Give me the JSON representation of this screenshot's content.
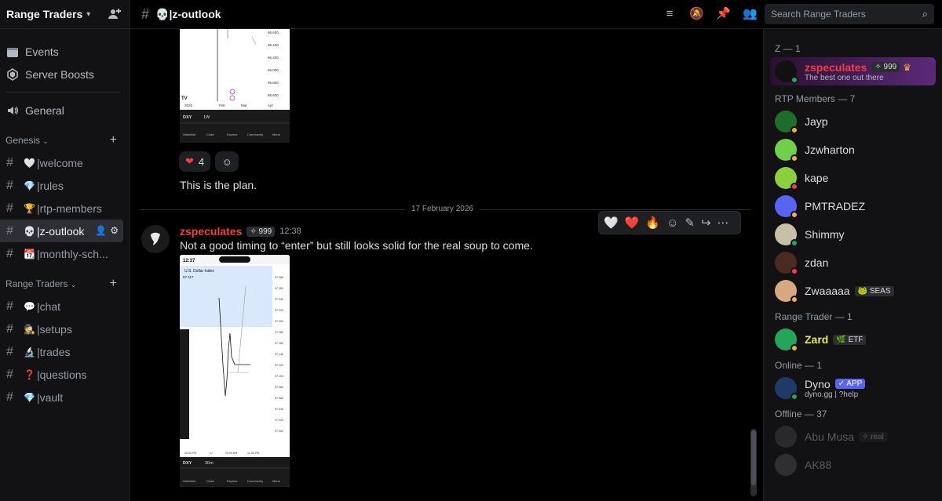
{
  "server": {
    "name": "Range Traders"
  },
  "nav": [
    {
      "label": "Events",
      "icon": "calendar-icon"
    },
    {
      "label": "Server Boosts",
      "icon": "boost-icon"
    },
    {
      "label": "General",
      "icon": "speaker-icon"
    }
  ],
  "categories": [
    {
      "label": "Genesis",
      "channels": [
        {
          "emoji": "🤍",
          "name": "|welcome"
        },
        {
          "emoji": "💎",
          "name": "|rules"
        },
        {
          "emoji": "🏆",
          "name": "|rtp-members"
        },
        {
          "emoji": "💀",
          "name": "|z-outlook",
          "active": true
        },
        {
          "emoji": "📆",
          "name": "|monthly-sch..."
        }
      ]
    },
    {
      "label": "Range Traders",
      "channels": [
        {
          "emoji": "💬",
          "name": "|chat"
        },
        {
          "emoji": "🕵",
          "name": "|setups"
        },
        {
          "emoji": "🔬",
          "name": "|trades"
        },
        {
          "emoji": "❓",
          "name": "|questions"
        },
        {
          "emoji": "💎",
          "name": "|vault"
        }
      ]
    }
  ],
  "topbar": {
    "title": "💀|z-outlook",
    "search_placeholder": "Search Range Traders"
  },
  "chat": {
    "prev": {
      "reaction_count": "4",
      "text": "This is the plan."
    },
    "divider": "17 February 2026",
    "msg": {
      "author": "zspeculates",
      "badge": "✧ 999",
      "time": "12:38",
      "text": "Not a good timing to “enter” but still looks solid for the real soup to come."
    },
    "hover_reactions": [
      "🤍",
      "❤️",
      "🔥"
    ]
  },
  "members": {
    "groups": [
      {
        "label": "Z — 1"
      },
      {
        "label": "RTP Members — 7"
      },
      {
        "label": "Range Trader — 1"
      },
      {
        "label": "Online — 1"
      },
      {
        "label": "Offline — 37"
      }
    ],
    "z": {
      "name": "zspeculates",
      "tag": "✧ 999",
      "status": "The best one out there"
    },
    "rtp": [
      "Jayp",
      "Jzwharton",
      "kape",
      "PMTRADEZ",
      "Shimmy",
      "zdan",
      "Zwaaaaa"
    ],
    "zwa_tag": "🐸 SEAS",
    "rt": {
      "name": "Zard",
      "tag": "🌿 ETF"
    },
    "online": {
      "name": "Dyno",
      "tag": "✓ APP",
      "status": "dyno.gg | ?help"
    },
    "offline": [
      "Abu Musa",
      "AK88"
    ],
    "offline_tag": "✧ real"
  },
  "chart1": {
    "ticks": [
      "96.600",
      "96.400",
      "96.200",
      "96.000",
      "95.800",
      "95.600"
    ],
    "toolbar": [
      "DXY",
      "1W"
    ],
    "bottom": [
      "Watchlist",
      "Chart",
      "Explore",
      "Community",
      "Menu"
    ],
    "x_labels": [
      "2026",
      "Feb",
      "Mar",
      "Apr"
    ]
  },
  "chart2": {
    "time": "12:37",
    "title": "U.S. Dollar Index",
    "value": "97.117",
    "ticks": [
      "97.280",
      "97.260",
      "97.240",
      "97.220",
      "97.200",
      "97.180",
      "97.160",
      "97.140",
      "97.120",
      "97.100",
      "97.080",
      "97.060",
      "97.040",
      "97.020",
      "97.000"
    ],
    "x_labels": [
      "20:00 PM",
      "17",
      "00:00 AM",
      "12:00 PM"
    ],
    "toolbar": [
      "DXY",
      "30m"
    ],
    "bottom": [
      "Watchlist",
      "Chart",
      "Explore",
      "Community",
      "Menu"
    ]
  }
}
